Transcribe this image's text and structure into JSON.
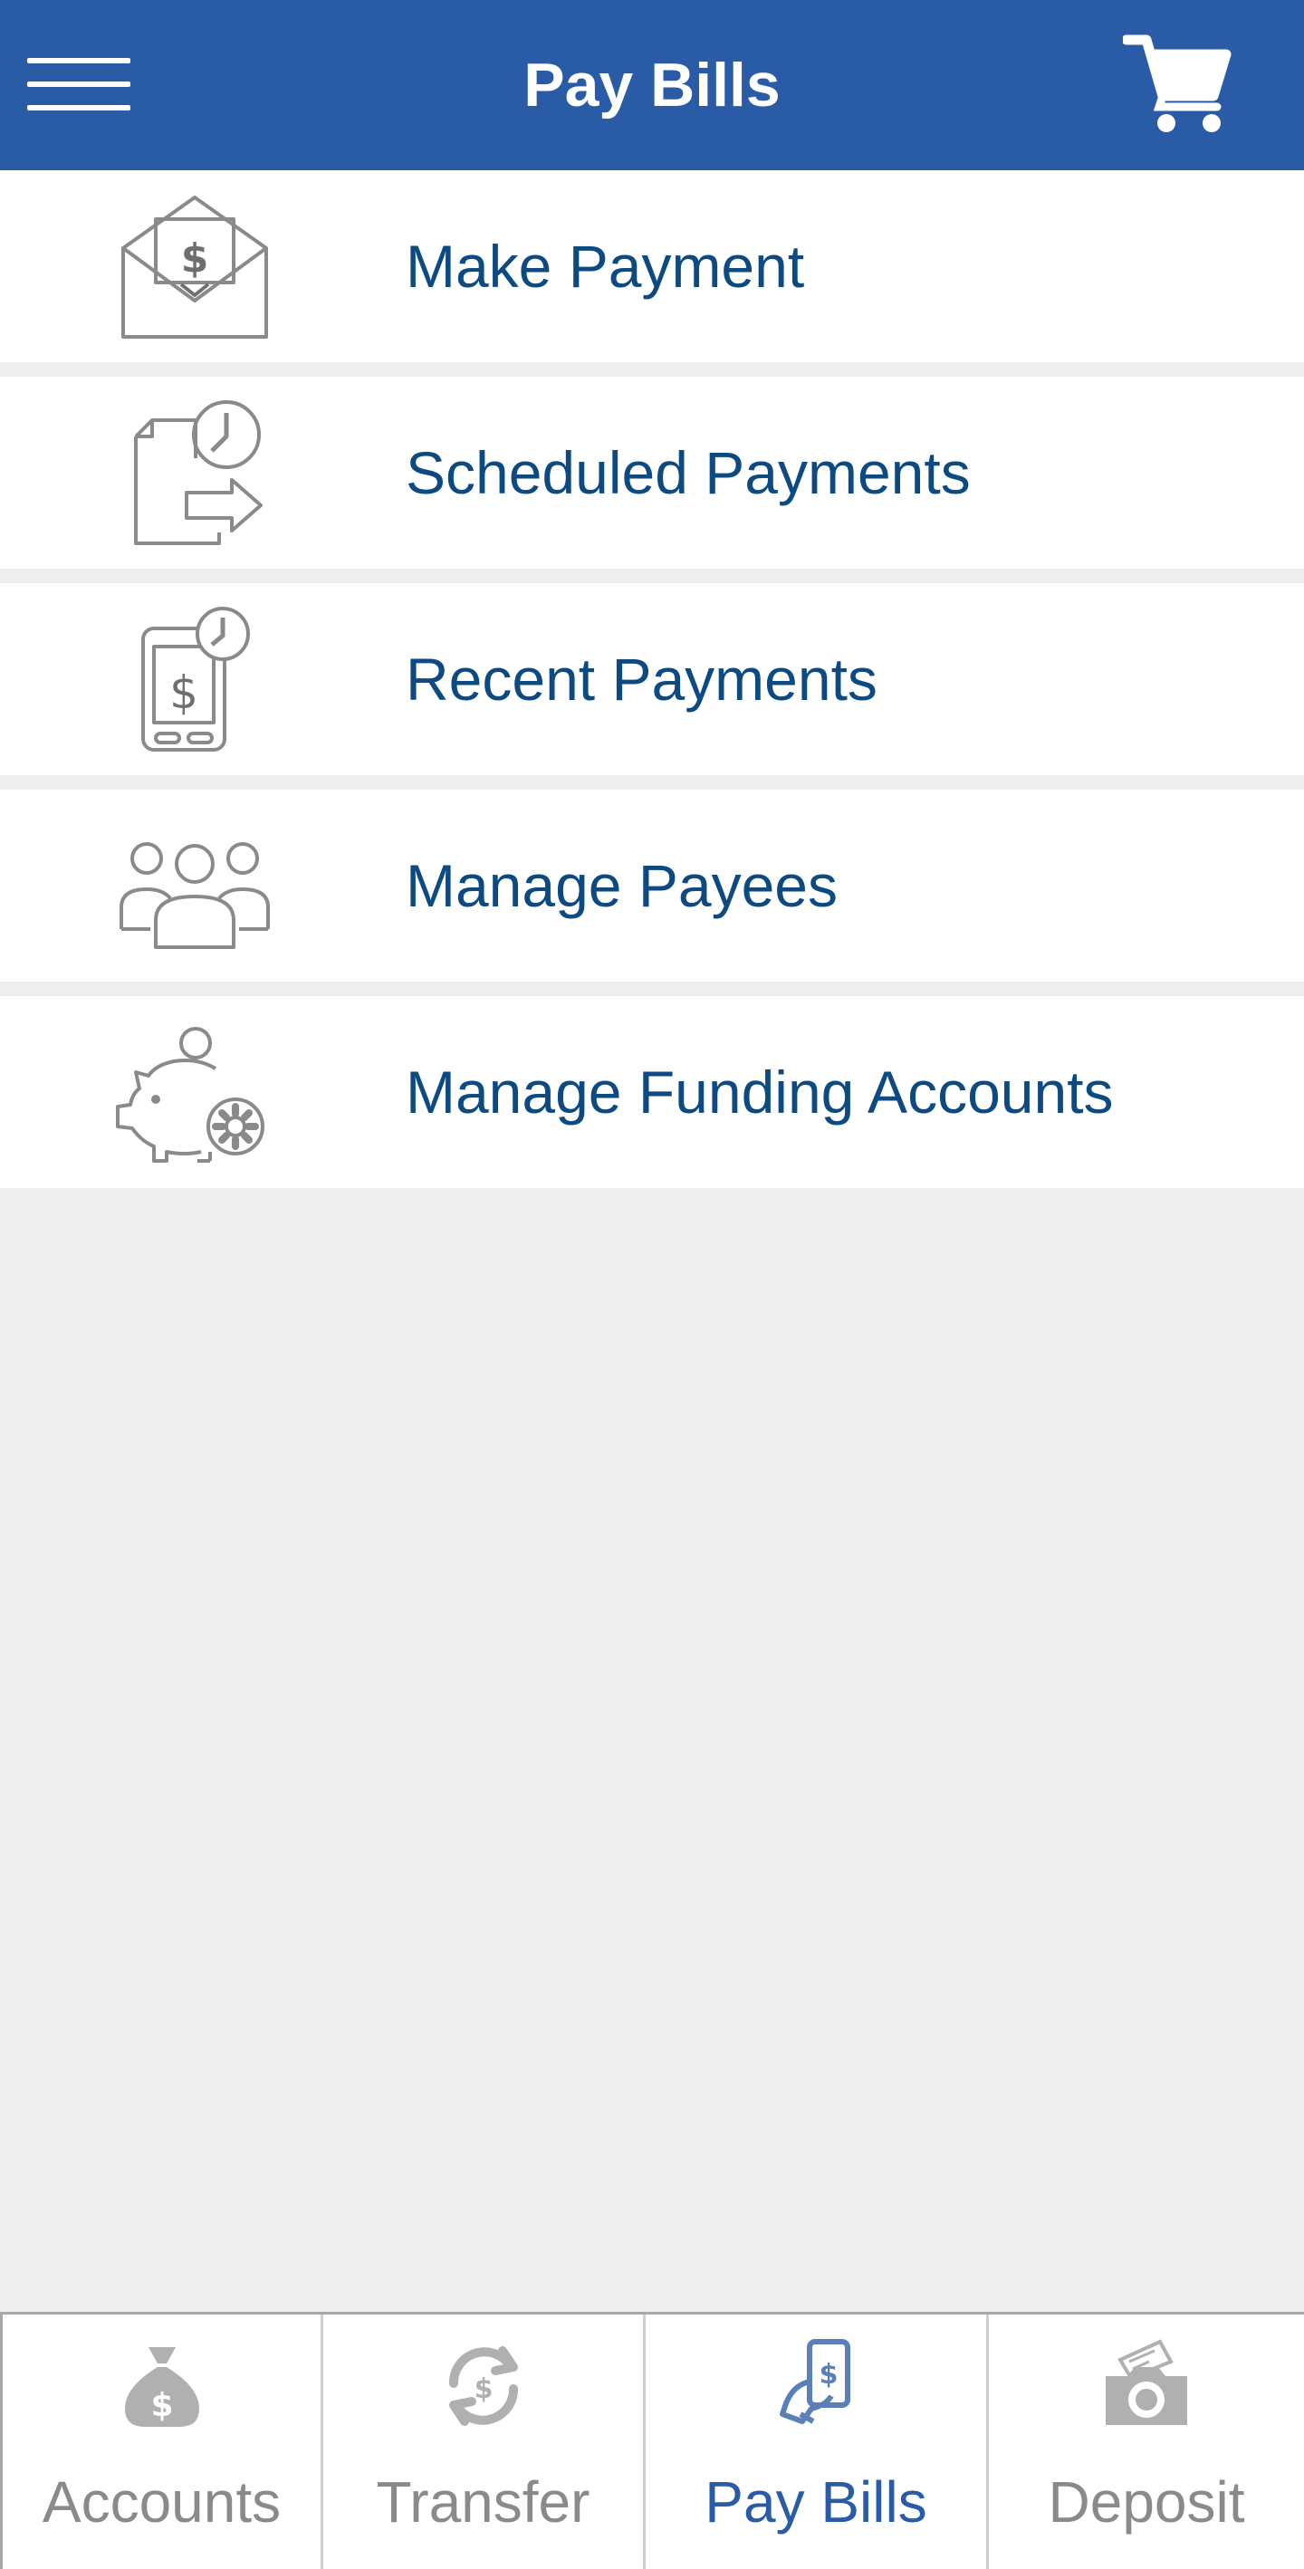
{
  "header": {
    "title": "Pay Bills",
    "menu_icon": "hamburger-menu-icon",
    "cart_icon": "shopping-cart-icon"
  },
  "menu": {
    "items": [
      {
        "label": "Make Payment",
        "icon": "envelope-dollar-icon"
      },
      {
        "label": "Scheduled Payments",
        "icon": "document-clock-arrow-icon"
      },
      {
        "label": "Recent Payments",
        "icon": "phone-dollar-clock-icon"
      },
      {
        "label": "Manage Payees",
        "icon": "people-group-icon"
      },
      {
        "label": "Manage Funding Accounts",
        "icon": "piggy-bank-gear-icon"
      }
    ]
  },
  "tabbar": {
    "active": "Pay Bills",
    "tabs": [
      {
        "label": "Accounts",
        "icon": "money-bag-icon"
      },
      {
        "label": "Transfer",
        "icon": "transfer-cycle-icon"
      },
      {
        "label": "Pay Bills",
        "icon": "pay-bills-phone-icon"
      },
      {
        "label": "Deposit",
        "icon": "camera-check-icon"
      }
    ]
  },
  "colors": {
    "header_bg": "#2a5ba7",
    "menu_label": "#0d4a82",
    "icon_gray": "#8a8a8a",
    "page_bg": "#efefef",
    "active_tab": "#2a5ba7"
  }
}
